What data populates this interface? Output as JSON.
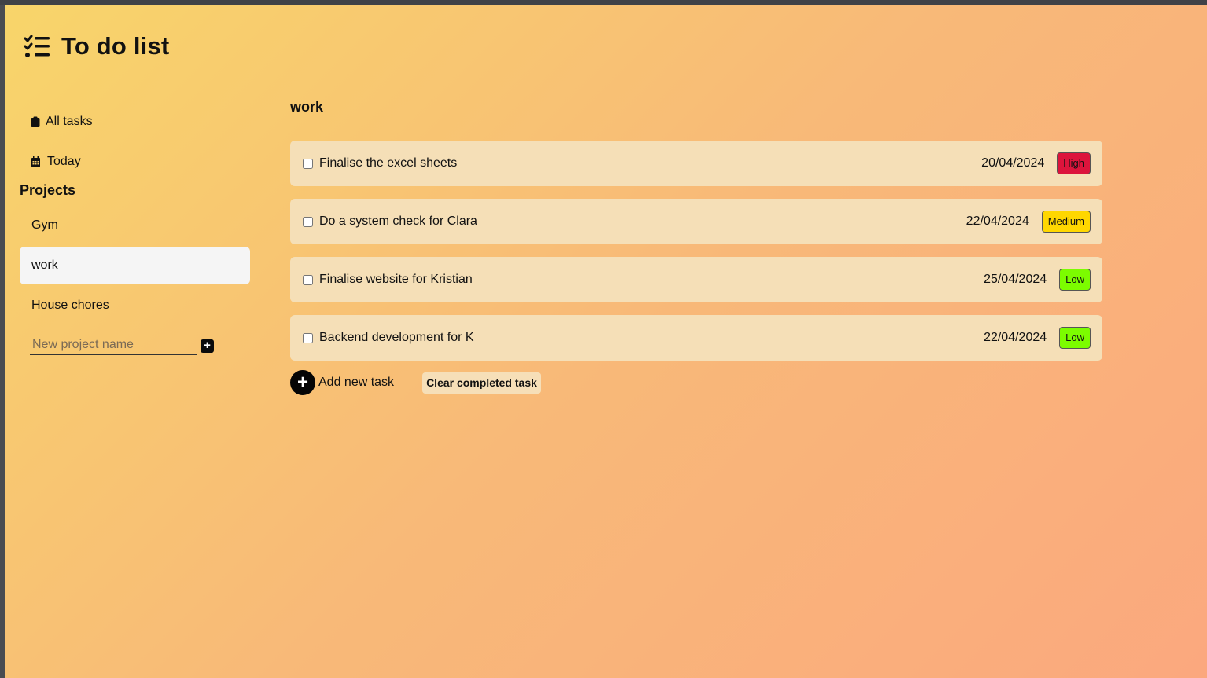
{
  "app": {
    "title": "To do list"
  },
  "sidebar": {
    "nav": [
      {
        "label": "All tasks",
        "icon": "clipboard-icon"
      },
      {
        "label": "Today",
        "icon": "calendar-icon"
      }
    ],
    "projects_title": "Projects",
    "projects": [
      {
        "label": "Gym",
        "active": false
      },
      {
        "label": "work",
        "active": true
      },
      {
        "label": "House chores",
        "active": false
      }
    ],
    "new_project": {
      "placeholder": "New project name",
      "value": "",
      "add_icon": "plus-square-icon"
    }
  },
  "main": {
    "heading": "work",
    "tasks": [
      {
        "title": "Finalise the excel sheets",
        "date": "20/04/2024",
        "priority": "High",
        "priority_color": "#dc143c",
        "done": false
      },
      {
        "title": "Do a system check for Clara",
        "date": "22/04/2024",
        "priority": "Medium",
        "priority_color": "#ffd700",
        "done": false
      },
      {
        "title": "Finalise website for Kristian",
        "date": "25/04/2024",
        "priority": "Low",
        "priority_color": "#7cfc00",
        "done": false
      },
      {
        "title": "Backend development for K",
        "date": "22/04/2024",
        "priority": "Low",
        "priority_color": "#7cfc00",
        "done": false
      }
    ],
    "add_task_label": "Add new task",
    "add_task_icon": "plus-circle-icon",
    "clear_label": "Clear completed task"
  },
  "colors": {
    "gradient_start": "#f8d56a",
    "gradient_end": "#fba87e",
    "task_bg": "#f5dfb7",
    "active_project_bg": "#f5f5f5"
  }
}
